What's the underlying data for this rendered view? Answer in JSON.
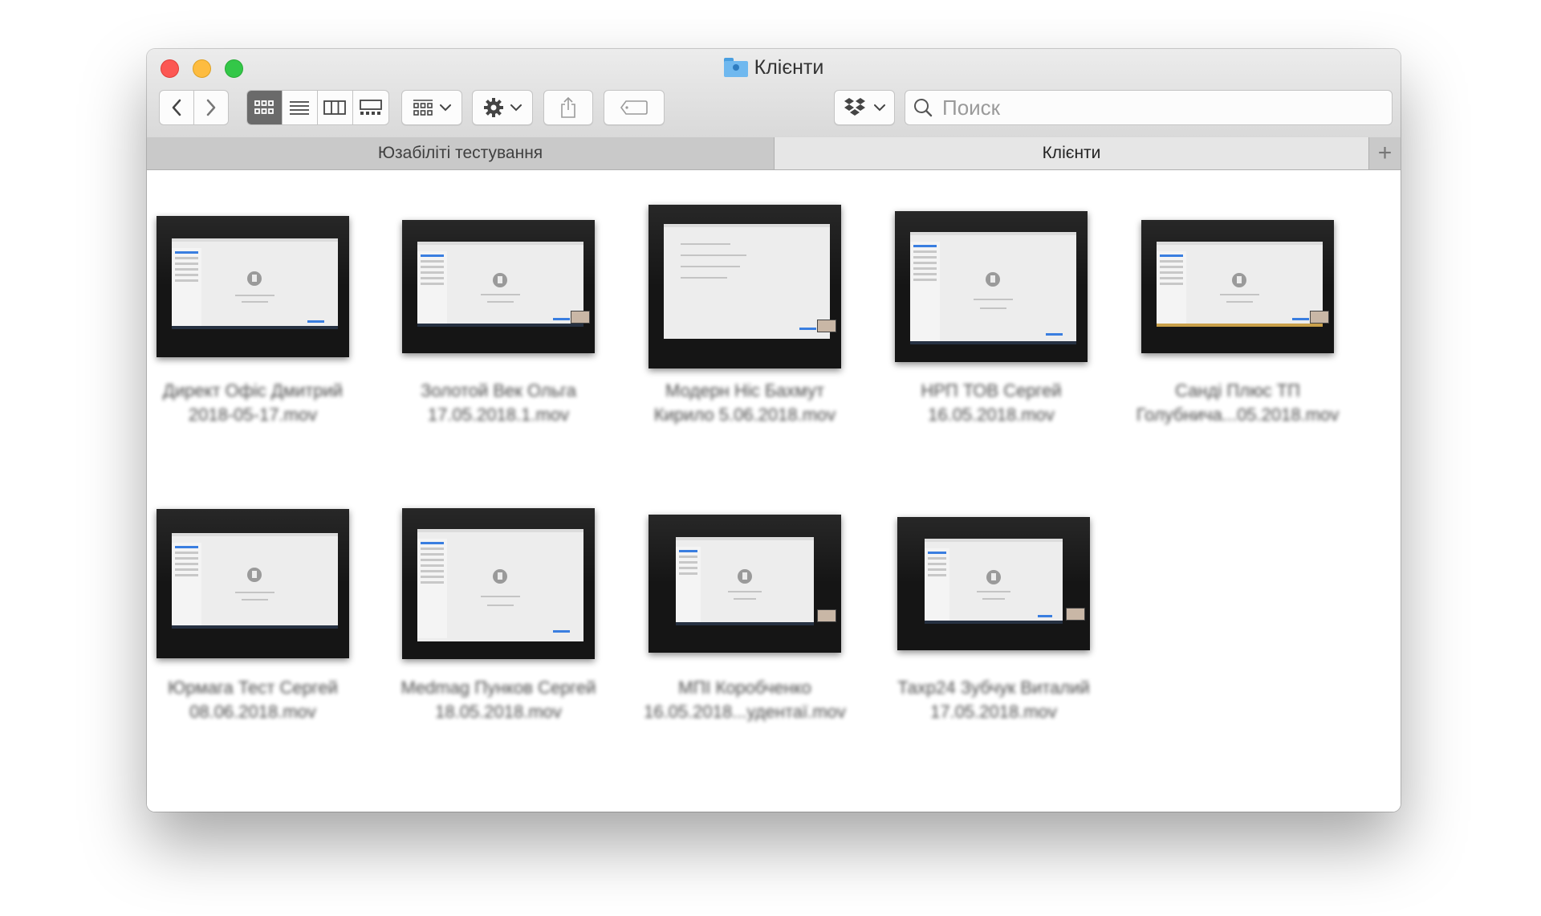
{
  "window": {
    "title": "Клієнти",
    "folder_icon": "user-folder-icon"
  },
  "toolbar": {
    "back_icon": "chevron-left-icon",
    "forward_icon": "chevron-right-icon",
    "view_modes": [
      "icon-view",
      "list-view",
      "column-view",
      "gallery-view"
    ],
    "active_view": "icon-view",
    "group_icon": "group-by-icon",
    "action_icon": "gear-icon",
    "share_icon": "share-icon",
    "tag_icon": "tag-icon",
    "dropbox_icon": "dropbox-icon"
  },
  "search": {
    "placeholder": "Поиск"
  },
  "tabs": [
    {
      "label": "Юзабіліті тестування",
      "active": false
    },
    {
      "label": "Клієнти",
      "active": true
    }
  ],
  "add_tab_icon": "plus-icon",
  "files": [
    {
      "line1": "Директ Офіс Дмитрий",
      "line2": "2018-05-17.mov"
    },
    {
      "line1": "Золотой Век Ольга",
      "line2": "17.05.2018.1.mov"
    },
    {
      "line1": "Модерн Ніс Бахмут",
      "line2": "Кирило 5.06.2018.mov"
    },
    {
      "line1": "НРП ТОВ Сергей",
      "line2": "16.05.2018.mov"
    },
    {
      "line1": "Санді Плюс ТП",
      "line2": "Голубнича...05.2018.mov"
    },
    {
      "line1": "Юрмага Тест Сергей",
      "line2": "08.06.2018.mov"
    },
    {
      "line1": "Medmag Пунков Сергей",
      "line2": "18.05.2018.mov"
    },
    {
      "line1": "МПІ Коробченко",
      "line2": "16.05.2018...удентаї.mov"
    },
    {
      "line1": "Тахр24 Зубчук Виталий",
      "line2": "17.05.2018.mov"
    }
  ],
  "colors": {
    "close": "#fc5753",
    "minimize": "#fdbc40",
    "zoom": "#33c748",
    "selected_segment": "#6a6a6a",
    "accent": "#3a7ee0"
  }
}
